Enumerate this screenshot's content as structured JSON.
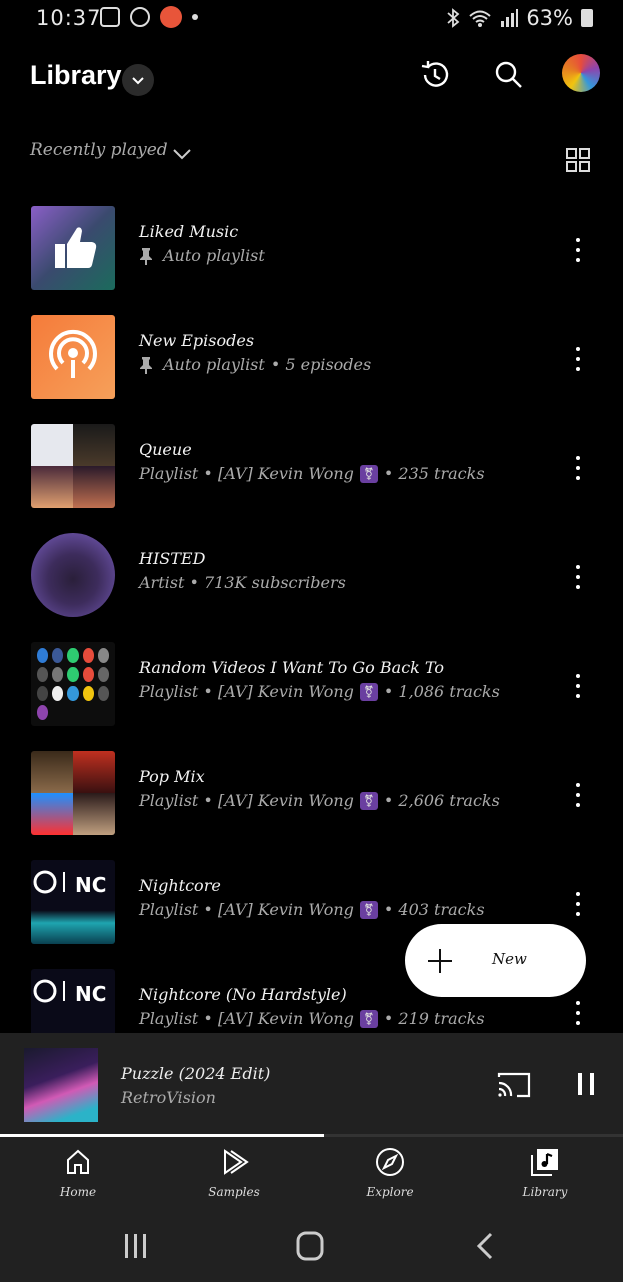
{
  "status_bar": {
    "time": "10:37",
    "battery": "63%"
  },
  "header": {
    "title": "Library"
  },
  "filter": {
    "label": "Recently played"
  },
  "items": [
    {
      "title": "Liked Music",
      "subtitle": "Auto playlist",
      "pinned": true,
      "subtitle_extra": ""
    },
    {
      "title": "New Episodes",
      "subtitle": "Auto playlist",
      "pinned": true,
      "subtitle_extra": "• 5 episodes"
    },
    {
      "title": "Queue",
      "subtitle": "Playlist • [AV] Kevin Wong",
      "pinned": false,
      "subtitle_extra": "• 235 tracks"
    },
    {
      "title": "HISTED",
      "subtitle": "Artist • 713K subscribers",
      "pinned": false,
      "subtitle_extra": ""
    },
    {
      "title": "Random Videos I Want To Go Back To",
      "subtitle": "Playlist • [AV] Kevin Wong",
      "pinned": false,
      "subtitle_extra": "• 1,086 tracks"
    },
    {
      "title": "Pop Mix",
      "subtitle": "Playlist • [AV] Kevin Wong",
      "pinned": false,
      "subtitle_extra": "• 2,606 tracks"
    },
    {
      "title": "Nightcore",
      "subtitle": "Playlist • [AV] Kevin Wong",
      "pinned": false,
      "subtitle_extra": "• 403 tracks"
    },
    {
      "title": "Nightcore (No Hardstyle)",
      "subtitle": "Playlist • [AV] Kevin Wong",
      "pinned": false,
      "subtitle_extra": "• 219 tracks"
    }
  ],
  "fab": {
    "label": "New"
  },
  "now_playing": {
    "title": "Puzzle (2024 Edit)",
    "artist": "RetroVision",
    "progress": 0.52
  },
  "bottom_nav": [
    {
      "label": "Home",
      "icon": "home-icon"
    },
    {
      "label": "Samples",
      "icon": "samples-icon"
    },
    {
      "label": "Explore",
      "icon": "explore-icon"
    },
    {
      "label": "Library",
      "icon": "library-icon"
    }
  ],
  "colors": {
    "background": "#000000",
    "surface": "#212121",
    "subtext": "#aaaaaa"
  }
}
